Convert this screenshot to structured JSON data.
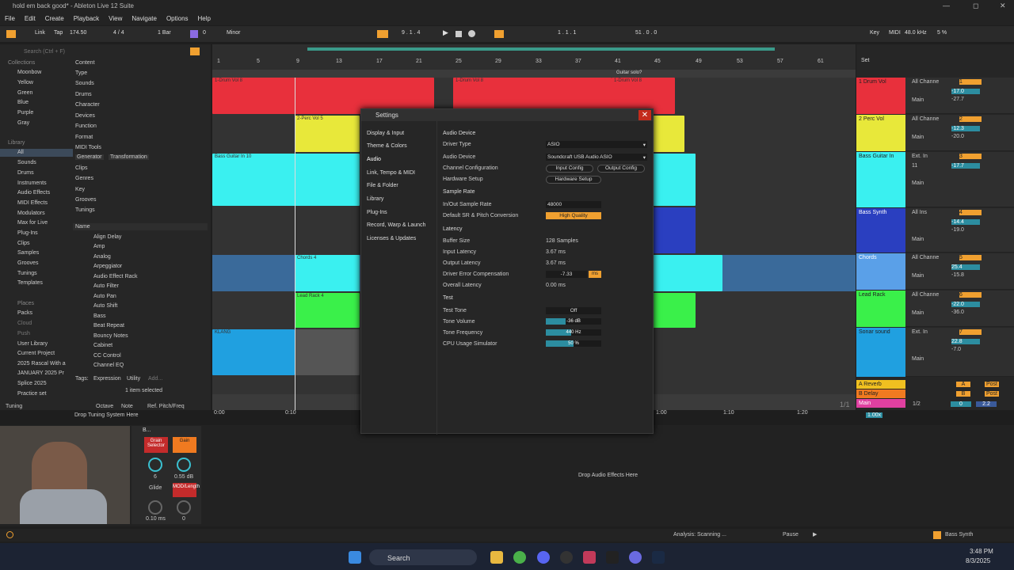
{
  "window": {
    "title": "hold em back good* - Ableton Live 12 Suite",
    "controls": [
      "—",
      "◻",
      "✕"
    ]
  },
  "menu": [
    "File",
    "Edit",
    "Create",
    "Playback",
    "View",
    "Navigate",
    "Options",
    "Help"
  ],
  "toolbar": {
    "link": "Link",
    "tap": "Tap",
    "tempo": "174.50",
    "meter": "4 / 4",
    "quant": "1 Bar",
    "key_num": "0",
    "scale": "Minor",
    "position": "9 . 1 . 4",
    "loop_start": "1 . 1 . 1",
    "loop_len": "51 . 0 . 0",
    "key": "Key",
    "midi": "MIDI",
    "sr": "48.0 kHz",
    "cpu": "5 %"
  },
  "browser": {
    "search_placeholder": "Search (Ctrl + F)",
    "collections_label": "Collections",
    "collections": [
      "Moonbow",
      "Yellow",
      "Green",
      "Blue",
      "Purple",
      "Gray"
    ],
    "collection_colors": [
      "#e04b4b",
      "#e8d84a",
      "#5ec95e",
      "#4a8de0",
      "#a45ee0",
      "#999999"
    ],
    "library_label": "Library",
    "library": [
      "All",
      "Sounds",
      "Drums",
      "Instruments",
      "Audio Effects",
      "MIDI Effects",
      "Modulators",
      "Max for Live",
      "Plug-Ins",
      "Clips",
      "Samples",
      "Grooves",
      "Tunings",
      "Templates"
    ],
    "places_label": "Places",
    "places": [
      "Packs",
      "Cloud",
      "Push",
      "User Library",
      "Current Project",
      "2025 Rascal With a",
      "JANUARY 2025 Pr",
      "Splice 2025",
      "Practice set"
    ],
    "filters": [
      "Content",
      "Type",
      "Sounds",
      "Drums",
      "Character",
      "Devices",
      "Function",
      "Format",
      "MIDI Tools",
      "Clips",
      "Genres",
      "Key",
      "Grooves",
      "Tunings"
    ],
    "filter_tags": [
      "Generator",
      "Transformation"
    ],
    "name_header": "Name",
    "items": [
      "Align Delay",
      "Amp",
      "Analog",
      "Arpeggiator",
      "Audio Effect Rack",
      "Auto Filter",
      "Auto Pan",
      "Auto Shift",
      "Bass",
      "Beat Repeat",
      "Bouncy Notes",
      "Cabinet",
      "CC Control",
      "Channel EQ"
    ],
    "tags_label": "Tags:",
    "tags": [
      "Expression",
      "Utility",
      "Add..."
    ],
    "selected_count": "1 item selected",
    "tuning_label": "Tuning",
    "octave": "Octave",
    "note": "Note",
    "ref": "Ref. Pitch/Freq",
    "drop_tuning": "Drop Tuning System Here"
  },
  "ruler": [
    "1",
    "5",
    "9",
    "13",
    "17",
    "21",
    "25",
    "29",
    "33",
    "37",
    "41",
    "45",
    "49",
    "53",
    "57",
    "61"
  ],
  "time_ruler": [
    "0:00",
    "0:10",
    "1:00",
    "1:10",
    "1:20"
  ],
  "clips": {
    "drum": "1-Drum Vol 8",
    "drum2": "1-Drum Vol 8",
    "drum3": "1-Drum Vol 8",
    "guitar_solo": "Guitar solo?",
    "perc": "2-Perc Vol 5",
    "bass": "Bass Guitar In 10",
    "chords": "Chords 4",
    "lead": "Lead Rack 4",
    "klang": "KLANG"
  },
  "tracks": [
    {
      "name": "1 Drum Vol",
      "color": "#e8303c",
      "input": "All Channe",
      "num": "1",
      "vol": "-17.0",
      "sub": "-27.7",
      "out": "Main"
    },
    {
      "name": "2 Perc Vol",
      "color": "#e8e83a",
      "input": "All Channe",
      "num": "2",
      "vol": "-12.3",
      "sub": "-20.0",
      "out": "Main"
    },
    {
      "name": "Bass Guitar In",
      "color": "#3af0f0",
      "input": "Ext. In",
      "num": "3",
      "vol": "-17.7",
      "sub": "11",
      "out": "Main"
    },
    {
      "name": "Bass Synth",
      "color": "#2a3fc0",
      "input": "All Ins",
      "num": "4",
      "vol": "-14.4",
      "sub": "-19.0",
      "out": "Main"
    },
    {
      "name": "Chords",
      "color": "#5aa0e8",
      "input": "All Channe",
      "num": "5",
      "vol": "25.4",
      "sub": "-15.8",
      "out": "Main"
    },
    {
      "name": "Lead Rack",
      "color": "#3af04a",
      "input": "All Channe",
      "num": "6",
      "vol": "-22.0",
      "sub": "-36.0",
      "out": "Main"
    },
    {
      "name": "Sonar sound",
      "color": "#20a0e0",
      "input": "Ext. In",
      "num": "7",
      "vol": "22.8",
      "sub": "-7.0",
      "out": "Main"
    }
  ],
  "returns": [
    {
      "name": "A Reverb",
      "color": "#f0c020",
      "letter": "A",
      "post": "Post"
    },
    {
      "name": "B Delay",
      "color": "#f07a20",
      "letter": "B",
      "post": "Post"
    },
    {
      "name": "Main",
      "color": "#e040a0",
      "num": "1/2",
      "vol": "0",
      "pan": "2.2"
    }
  ],
  "mixer_misc": {
    "in": "In",
    "auto": "Auto",
    "off": "Off",
    "set": "Set",
    "s": "S",
    "c": "C",
    "page": "1/1",
    "zoom": "1.00x"
  },
  "settings": {
    "title": "Settings",
    "nav": [
      "Display & Input",
      "Theme & Colors",
      "Audio",
      "Link, Tempo & MIDI",
      "File & Folder",
      "Library",
      "Plug-Ins",
      "Record, Warp & Launch",
      "Licenses & Updates"
    ],
    "audio_device_header": "Audio Device",
    "driver_type_label": "Driver Type",
    "driver_type": "ASIO",
    "audio_device_label": "Audio Device",
    "audio_device": "Soundcraft USB Audio ASIO",
    "channel_config_label": "Channel Configuration",
    "input_config": "Input Config",
    "output_config": "Output Config",
    "hw_setup_label": "Hardware Setup",
    "hw_setup_btn": "Hardware Setup",
    "sample_rate_header": "Sample Rate",
    "sr_label": "In/Out Sample Rate",
    "sr_value": "48000",
    "sr_conv_label": "Default SR & Pitch Conversion",
    "sr_conv": "High Quality",
    "latency_header": "Latency",
    "buffer_label": "Buffer Size",
    "buffer_value": "128 Samples",
    "in_lat_label": "Input Latency",
    "in_lat": "3.67 ms",
    "out_lat_label": "Output Latency",
    "out_lat": "3.67 ms",
    "drv_comp_label": "Driver Error Compensation",
    "drv_comp": "-7.33",
    "drv_unit": "ms",
    "overall_label": "Overall Latency",
    "overall": "0.00 ms",
    "test_header": "Test",
    "tone_label": "Test Tone",
    "tone": "Off",
    "tone_vol_label": "Tone Volume",
    "tone_vol": "-36 dB",
    "tone_vol_frac": 0.35,
    "tone_freq_label": "Tone Frequency",
    "tone_freq": "440 Hz",
    "tone_freq_frac": 0.45,
    "cpu_label": "CPU Usage Simulator",
    "cpu": "50 %",
    "cpu_frac": 0.5
  },
  "device": {
    "title": "B...",
    "knob1_label": "Grain Selector",
    "knob2_label": "Gain",
    "knob1_val": "6",
    "knob2_val": "0.55 dB",
    "glide": "Glide",
    "mod": "MOD/Length",
    "glide_val": "0.10 ms",
    "mod_val": "0"
  },
  "drop_effects": "Drop Audio Effects Here",
  "status": {
    "analysis": "Analysis: Scanning ...",
    "pause": "Pause",
    "track": "Bass Synth"
  },
  "taskbar": {
    "search": "Search",
    "time": "3:48 PM",
    "date": "8/3/2025"
  }
}
